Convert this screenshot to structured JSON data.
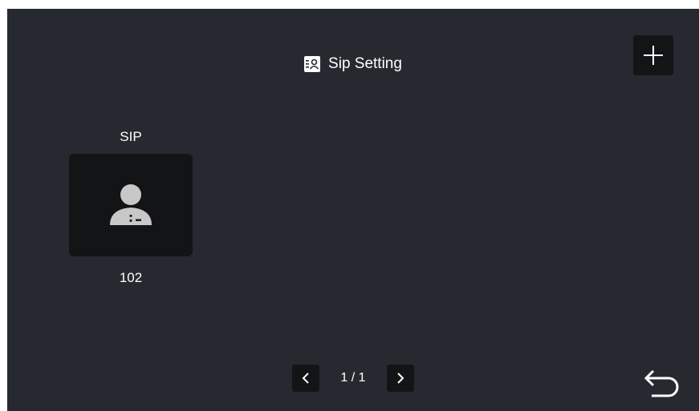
{
  "header": {
    "title": "Sip Setting",
    "icon": "contact-card-icon"
  },
  "actions": {
    "add_icon": "plus-icon",
    "back_icon": "back-arrow-icon"
  },
  "contacts": [
    {
      "label": "SIP",
      "number": "102",
      "icon": "user-avatar-icon"
    }
  ],
  "pagination": {
    "text": "1 / 1",
    "prev_icon": "chevron-left-icon",
    "next_icon": "chevron-right-icon"
  },
  "colors": {
    "background": "#262a30",
    "button": "#121416",
    "text": "#ffffff",
    "icon": "#c8c8c8"
  }
}
